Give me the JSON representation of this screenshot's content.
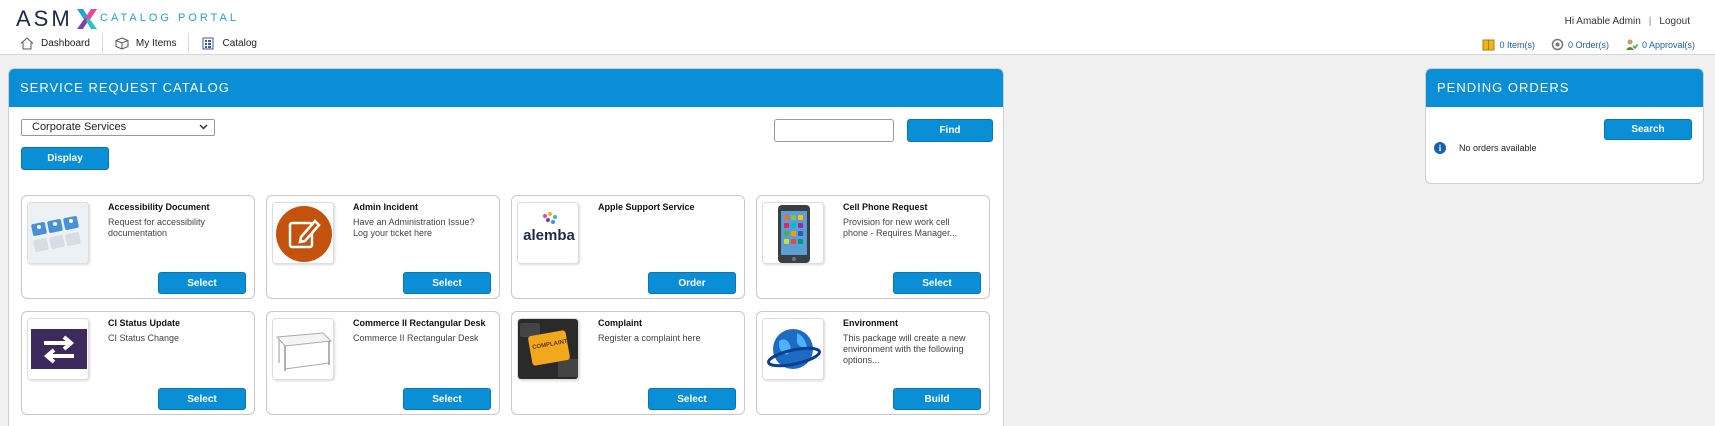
{
  "header": {
    "logo_text": "ASM",
    "portal_title": "CATALOG PORTAL",
    "greeting": "Hi Amable Admin",
    "logout_label": "Logout"
  },
  "nav": {
    "items": [
      {
        "label": "Dashboard",
        "icon": "home-icon"
      },
      {
        "label": "My Items",
        "icon": "box-icon"
      },
      {
        "label": "Catalog",
        "icon": "catalog-icon"
      }
    ]
  },
  "counts": {
    "items": "0 Item(s)",
    "orders": "0 Order(s)",
    "approvals": "0 Approval(s)"
  },
  "catalog": {
    "title": "SERVICE REQUEST CATALOG",
    "category_selected": "Corporate Services",
    "search_value": "",
    "find_label": "Find",
    "display_label": "Display",
    "cards": [
      {
        "title": "Accessibility Document",
        "description": "Request for accessibility documentation",
        "button": "Select",
        "icon": "accessibility-keyboard-icon"
      },
      {
        "title": "Admin Incident",
        "description": "Have an Administration Issue? Log your ticket here",
        "button": "Select",
        "icon": "edit-pencil-icon"
      },
      {
        "title": "Apple Support Service",
        "description": "",
        "button": "Order",
        "icon": "alemba-logo"
      },
      {
        "title": "Cell Phone Request",
        "description": "Provision for new work cell phone - Requires Manager...",
        "button": "Select",
        "icon": "cell-phone-icon"
      },
      {
        "title": "CI Status Update",
        "description": "CI Status Change",
        "button": "Select",
        "icon": "swap-arrows-icon"
      },
      {
        "title": "Commerce II Rectangular Desk",
        "description": "Commerce II Rectangular Desk",
        "button": "Select",
        "icon": "desk-icon"
      },
      {
        "title": "Complaint",
        "description": "Register a complaint here",
        "button": "Select",
        "icon": "complaint-key-icon"
      },
      {
        "title": "Environment",
        "description": "This package will create a new environment with the following options...",
        "button": "Build",
        "icon": "globe-icon"
      }
    ],
    "alemba_text": "alemba",
    "complaint_key_text": "COMPLAINT"
  },
  "pending": {
    "title": "PENDING ORDERS",
    "search_label": "Search",
    "empty_message": "No orders available"
  },
  "colors": {
    "brand_blue": "#0a8fd6",
    "link_blue": "#1b5fb5",
    "logo_cyan": "#1fa3d8",
    "logo_pink": "#e8489a"
  }
}
